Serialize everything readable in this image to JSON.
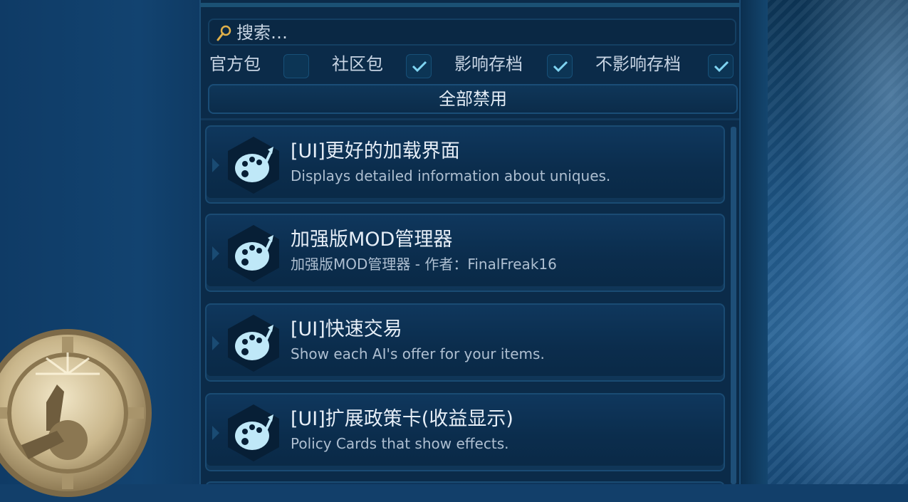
{
  "search": {
    "placeholder": "搜索…",
    "icon": "magnifier-icon"
  },
  "filters": [
    {
      "label": "官方包",
      "checked": false
    },
    {
      "label": "社区包",
      "checked": true
    },
    {
      "label": "影响存档",
      "checked": true
    },
    {
      "label": "不影响存档",
      "checked": true
    }
  ],
  "disable_all_label": "全部禁用",
  "mods": [
    {
      "title": "[UI]更好的加载界面",
      "description": "Displays detailed information about uniques.",
      "icon": "palette-icon"
    },
    {
      "title": "加强版MOD管理器",
      "description": "加强版MOD管理器 - 作者：FinalFreak16",
      "icon": "palette-icon"
    },
    {
      "title": "[UI]快速交易",
      "description": "Show each AI's offer for your items.",
      "icon": "palette-icon"
    },
    {
      "title": "[UI]扩展政策卡(收益显示)",
      "description": "Policy Cards that show effects.",
      "icon": "palette-icon"
    }
  ],
  "colors": {
    "panel": "#0b2b49",
    "accent": "#7fd4f2",
    "text": "#e6eef7"
  }
}
